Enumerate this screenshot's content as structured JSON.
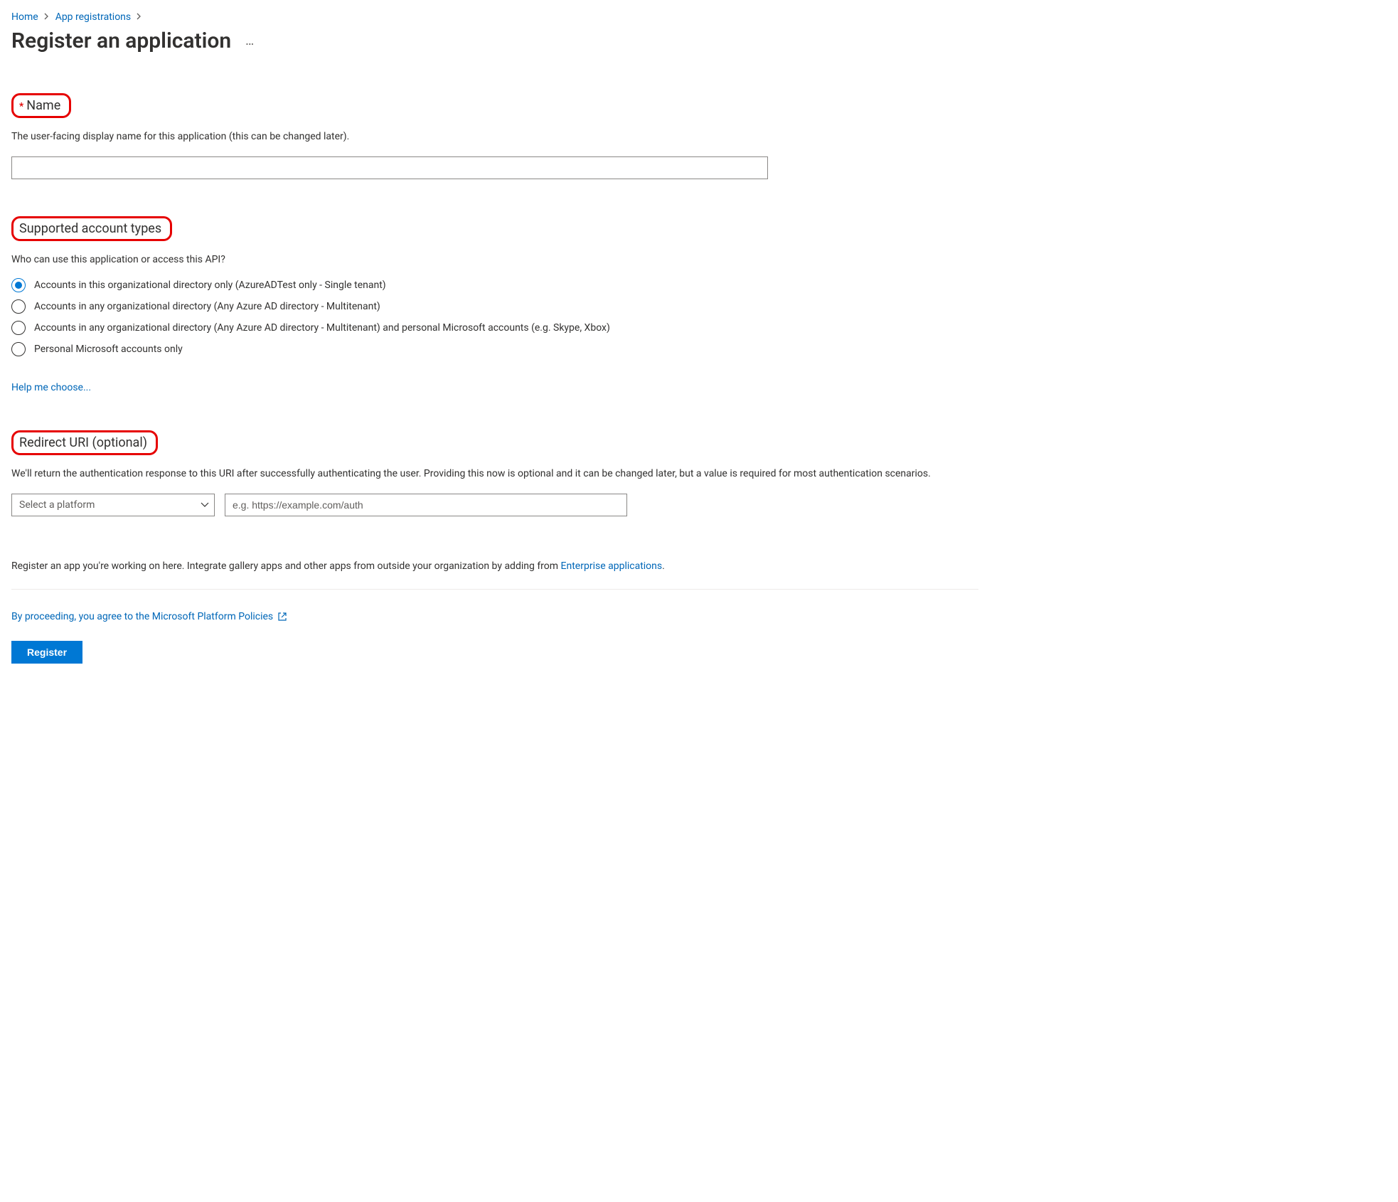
{
  "breadcrumbs": {
    "home": "Home",
    "app_registrations": "App registrations"
  },
  "page_title": "Register an application",
  "name_section": {
    "label": "Name",
    "help": "The user-facing display name for this application (this can be changed later).",
    "value": ""
  },
  "account_types": {
    "label": "Supported account types",
    "help": "Who can use this application or access this API?",
    "options": [
      "Accounts in this organizational directory only (AzureADTest only - Single tenant)",
      "Accounts in any organizational directory (Any Azure AD directory - Multitenant)",
      "Accounts in any organizational directory (Any Azure AD directory - Multitenant) and personal Microsoft accounts (e.g. Skype, Xbox)",
      "Personal Microsoft accounts only"
    ],
    "selected": 0,
    "help_link": "Help me choose..."
  },
  "redirect_uri": {
    "label": "Redirect URI (optional)",
    "help": "We'll return the authentication response to this URI after successfully authenticating the user. Providing this now is optional and it can be changed later, but a value is required for most authentication scenarios.",
    "platform_placeholder": "Select a platform",
    "uri_placeholder": "e.g. https://example.com/auth"
  },
  "footer": {
    "note_prefix": "Register an app you're working on here. Integrate gallery apps and other apps from outside your organization by adding from ",
    "note_link": "Enterprise applications",
    "note_suffix": ".",
    "policies": "By proceeding, you agree to the Microsoft Platform Policies",
    "register_btn": "Register"
  }
}
